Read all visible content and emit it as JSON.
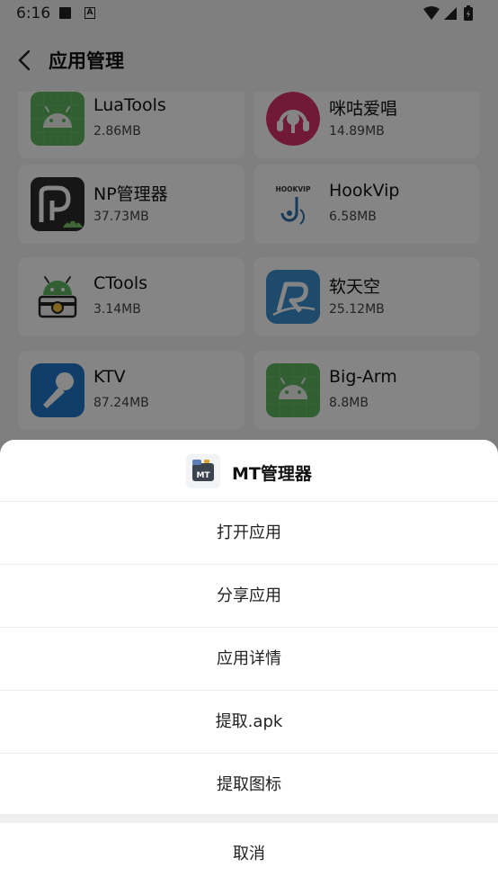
{
  "status_bar": {
    "time": "6:16",
    "notif_a": "A"
  },
  "header": {
    "title": "应用管理"
  },
  "apps": [
    {
      "name": "LuaTools",
      "size": "2.86MB",
      "icon": "android-icon"
    },
    {
      "name": "咪咕爱唱",
      "size": "14.89MB",
      "icon": "microphone-icon"
    },
    {
      "name": "NP管理器",
      "size": "37.73MB",
      "icon": "np-manager-icon"
    },
    {
      "name": "HookVip",
      "size": "6.58MB",
      "icon": "hookvip-icon",
      "icon_text": "HOOKVIP"
    },
    {
      "name": "CTools",
      "size": "3.14MB",
      "icon": "android-briefcase-icon"
    },
    {
      "name": "软天空",
      "size": "25.12MB",
      "icon": "r-logo-icon"
    },
    {
      "name": "KTV",
      "size": "87.24MB",
      "icon": "microphone-icon"
    },
    {
      "name": "Big-Arm",
      "size": "8.8MB",
      "icon": "android-icon"
    }
  ],
  "sheet": {
    "app_name": "MT管理器",
    "app_icon_text": "MT",
    "actions": [
      "打开应用",
      "分享应用",
      "应用详情",
      "提取.apk",
      "提取图标"
    ],
    "cancel": "取消"
  },
  "colors": {
    "accent_green": "#5fb760",
    "pink": "#d6336c",
    "blue": "#2b8fd4"
  }
}
